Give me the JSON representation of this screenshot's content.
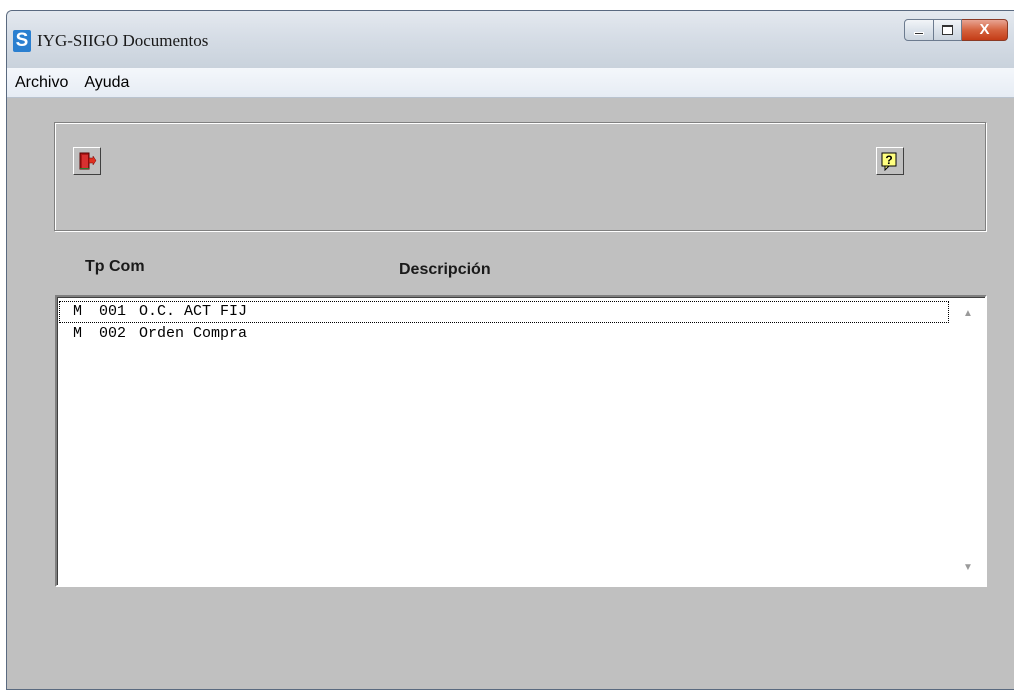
{
  "window": {
    "app_logo": "S",
    "title": "IYG-SIIGO Documentos",
    "close_glyph": "X"
  },
  "menu": {
    "items": [
      {
        "label": "Archivo"
      },
      {
        "label": "Ayuda"
      }
    ]
  },
  "toolbar": {
    "exit_icon": "exit-door-icon",
    "help_icon": "help-question-icon"
  },
  "list": {
    "headers": {
      "tp_com": "Tp Com",
      "descripcion": "Descripción"
    },
    "rows": [
      {
        "tp": "M",
        "com": "001",
        "descripcion": "O.C. ACT FIJ"
      },
      {
        "tp": "M",
        "com": "002",
        "descripcion": "Orden Compra"
      }
    ],
    "scroll_up_glyph": "▲",
    "scroll_down_glyph": "▼"
  },
  "colors": {
    "window_bg": "#c0c0c0",
    "titlebar": "#d6dde6",
    "list_bg": "#ffffff",
    "close_button": "#c43c17"
  }
}
